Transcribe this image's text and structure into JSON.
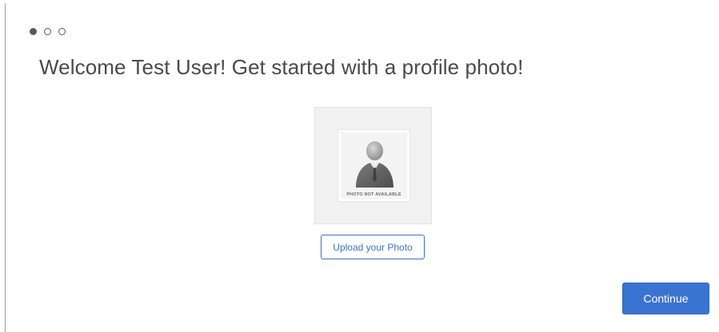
{
  "onboarding": {
    "steps": [
      {
        "state": "active"
      },
      {
        "state": "inactive"
      },
      {
        "state": "inactive"
      }
    ],
    "title": "Welcome Test User! Get started with a profile photo!",
    "photo": {
      "placeholder_text": "PHOTO NOT AVAILABLE",
      "icon": "person-silhouette-icon"
    },
    "upload_label": "Upload your Photo",
    "continue_label": "Continue"
  },
  "colors": {
    "accent": "#3b73d0",
    "text": "#4a4a4a",
    "dot_active": "#5a5a5a"
  }
}
